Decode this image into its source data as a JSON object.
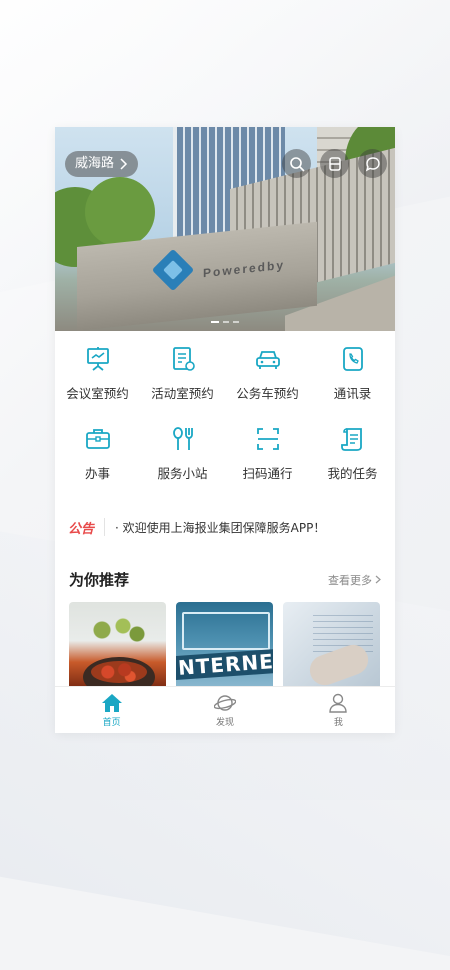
{
  "colors": {
    "accent": "#1aa7c4",
    "notice_red": "#e84a4a"
  },
  "banner": {
    "location_label": "威海路",
    "logo_text": "Poweredby",
    "icons": [
      "search-icon",
      "scan-icon",
      "message-icon"
    ],
    "slide_count": 3,
    "active_slide": 1
  },
  "services": [
    {
      "label": "会议室预约",
      "icon": "meeting-board-icon"
    },
    {
      "label": "活动室预约",
      "icon": "activity-document-icon"
    },
    {
      "label": "公务车预约",
      "icon": "car-icon"
    },
    {
      "label": "通讯录",
      "icon": "phone-book-icon"
    },
    {
      "label": "办事",
      "icon": "briefcase-icon"
    },
    {
      "label": "服务小站",
      "icon": "fork-spoon-icon"
    },
    {
      "label": "扫码通行",
      "icon": "scan-code-icon"
    },
    {
      "label": "我的任务",
      "icon": "task-scroll-icon"
    }
  ],
  "notice": {
    "tag": "公告",
    "message": "· 欢迎使用上海报业集团保障服务APP！"
  },
  "recommend": {
    "title": "为你推荐",
    "more_label": "查看更多",
    "card2_text": "NTERNET"
  },
  "tabbar": [
    {
      "label": "首页",
      "icon": "home-icon",
      "active": true
    },
    {
      "label": "发现",
      "icon": "planet-icon",
      "active": false
    },
    {
      "label": "我",
      "icon": "user-icon",
      "active": false
    }
  ]
}
